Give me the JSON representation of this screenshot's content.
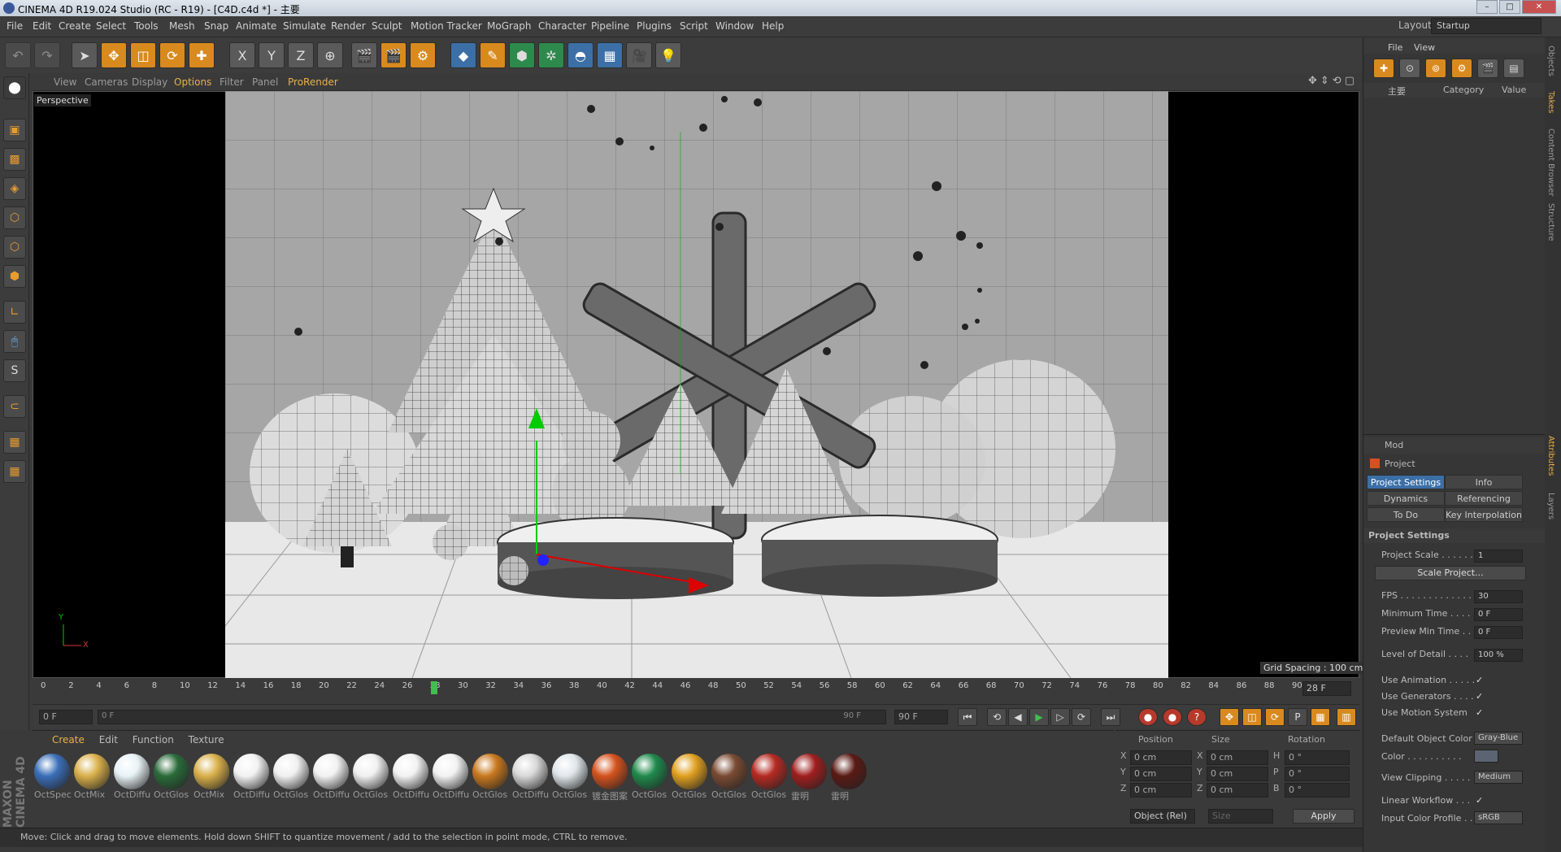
{
  "window": {
    "title": "CINEMA 4D R19.024 Studio (RC - R19) - [C4D.c4d *] - 主要"
  },
  "menu": [
    "File",
    "Edit",
    "Create",
    "Select",
    "Tools",
    "Mesh",
    "Snap",
    "Animate",
    "Simulate",
    "Render",
    "Sculpt",
    "Motion Tracker",
    "MoGraph",
    "Character",
    "Pipeline",
    "Plugins",
    "Script",
    "Window",
    "Help"
  ],
  "layout": {
    "label": "Layout:",
    "value": "Startup"
  },
  "toolbar": {
    "x_axis": "X",
    "y_axis": "Y",
    "z_axis": "Z"
  },
  "viewport": {
    "menu": [
      "View",
      "Cameras",
      "Display",
      "Options",
      "Filter",
      "Panel",
      "ProRender"
    ],
    "camera_label": "Perspective",
    "grid_spacing": "Grid Spacing : 100 cm",
    "axis_y": "Y",
    "axis_x": "X"
  },
  "timeline": {
    "ticks": [
      "0",
      "2",
      "4",
      "6",
      "8",
      "10",
      "12",
      "14",
      "16",
      "18",
      "20",
      "22",
      "24",
      "26",
      "28",
      "30",
      "32",
      "34",
      "36",
      "38",
      "40",
      "42",
      "44",
      "46",
      "48",
      "50",
      "52",
      "54",
      "56",
      "58",
      "60",
      "62",
      "64",
      "66",
      "68",
      "70",
      "72",
      "74",
      "76",
      "78",
      "80",
      "82",
      "84",
      "86",
      "88",
      "90"
    ],
    "current_frame": "28 F"
  },
  "transport": {
    "start": "0 F",
    "slider_start": "0 F",
    "slider_end": "90 F",
    "end": "90 F"
  },
  "materials": {
    "menu": [
      "Create",
      "Edit",
      "Function",
      "Texture"
    ],
    "items": [
      {
        "label": "OctSpec",
        "color": "#3a6fb8"
      },
      {
        "label": "OctMix",
        "color": "#d9b04a"
      },
      {
        "label": "OctDiffu",
        "color": "#e8f2f6"
      },
      {
        "label": "OctGlos",
        "color": "#2a6b3a"
      },
      {
        "label": "OctMix",
        "color": "#d9b04a"
      },
      {
        "label": "OctDiffu",
        "color": "#f2f2f2"
      },
      {
        "label": "OctGlos",
        "color": "#f0f0f0"
      },
      {
        "label": "OctDiffu",
        "color": "#f2f2f2"
      },
      {
        "label": "OctGlos",
        "color": "#f0f0f0"
      },
      {
        "label": "OctDiffu",
        "color": "#f2f2f2"
      },
      {
        "label": "OctDiffu",
        "color": "#f2f2f2"
      },
      {
        "label": "OctGlos",
        "color": "#c8781e"
      },
      {
        "label": "OctDiffu",
        "color": "#d8d8d8"
      },
      {
        "label": "OctGlos",
        "color": "#dfe6ea"
      },
      {
        "label": "镀金图案",
        "color": "#d4521e"
      },
      {
        "label": "OctGlos",
        "color": "#1f8a4c"
      },
      {
        "label": "OctGlos",
        "color": "#e0a020"
      },
      {
        "label": "OctGlos",
        "color": "#7a4a32"
      },
      {
        "label": "OctGlos",
        "color": "#b52a22"
      },
      {
        "label": "雷明",
        "color": "#a01e1e"
      },
      {
        "label": "雷明",
        "color": "#5a1a14"
      }
    ]
  },
  "coords": {
    "headers": [
      "Position",
      "Size",
      "Rotation"
    ],
    "rows": [
      {
        "axis": "X",
        "pos": "0 cm",
        "saxis": "X",
        "size": "0 cm",
        "raxis": "H",
        "rot": "0 °"
      },
      {
        "axis": "Y",
        "pos": "0 cm",
        "saxis": "Y",
        "size": "0 cm",
        "raxis": "P",
        "rot": "0 °"
      },
      {
        "axis": "Z",
        "pos": "0 cm",
        "saxis": "Z",
        "size": "0 cm",
        "raxis": "B",
        "rot": "0 °"
      }
    ],
    "mode": "Object (Rel)",
    "size_mode": "Size",
    "apply": "Apply"
  },
  "status": "Move: Click and drag to move elements. Hold down SHIFT to quantize movement / add to the selection in point mode, CTRL to remove.",
  "branding": "MAXON CINEMA 4D",
  "objects_panel": {
    "menu": [
      "File",
      "View"
    ],
    "col_name": "主要",
    "col_category": "Category",
    "col_value": "Value"
  },
  "attributes": {
    "mode": "Mod",
    "title": "Project",
    "tabs": [
      "Project Settings",
      "Info",
      "Dynamics",
      "Referencing",
      "To Do",
      "Key Interpolation"
    ],
    "section": "Project Settings",
    "fields": [
      {
        "label": "Project Scale . . . . . . .",
        "value": "1"
      },
      {
        "label": "FPS . . . . . . . . . . . . . .",
        "value": "30"
      },
      {
        "label": "Minimum Time . . . .",
        "value": "0 F"
      },
      {
        "label": "Preview Min Time . .",
        "value": "0 F"
      },
      {
        "label": "Level of Detail . . . .",
        "value": "100 %"
      }
    ],
    "scale_btn": "Scale Project...",
    "checks": [
      {
        "label": "Use Animation . . . . .",
        "value": "✓"
      },
      {
        "label": "Use Generators . . . .",
        "value": "✓"
      },
      {
        "label": "Use Motion System",
        "value": "✓"
      }
    ],
    "default_color_label": "Default Object Color",
    "default_color_value": "Gray-Blue",
    "color_label": "Color . . . . . . . . . .",
    "view_clipping_label": "View Clipping . . . . . .",
    "view_clipping_value": "Medium",
    "linear_workflow_label": "Linear Workflow . . .",
    "linear_workflow_value": "✓",
    "input_profile_label": "Input Color Profile . .",
    "input_profile_value": "sRGB"
  },
  "side_tabs": [
    "Objects",
    "Takes",
    "Content Browser",
    "Structure",
    "Attributes",
    "Layers"
  ]
}
